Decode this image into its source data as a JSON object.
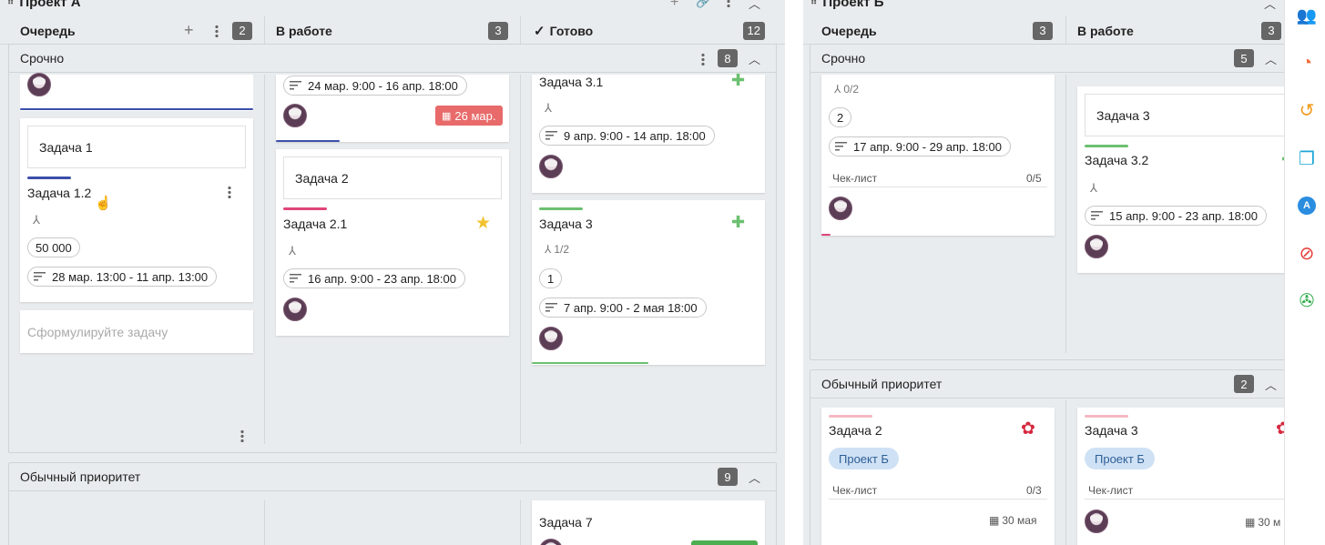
{
  "projectA": {
    "title": "Проект А",
    "columns": [
      {
        "label": "Очередь",
        "count": "2"
      },
      {
        "label": "В работе",
        "count": "3"
      },
      {
        "label": "Готово",
        "count": "12"
      }
    ],
    "urgent": {
      "label": "Срочно",
      "count": "8"
    },
    "normal": {
      "label": "Обычный приоритет",
      "count": "9"
    },
    "cards": {
      "task1_text": "Задача 1",
      "task12_title": "Задача 1.2",
      "task12_amount": "50 000",
      "task12_dates": "28 мар. 13:00 - 11 апр. 13:00",
      "new_task_placeholder": "Сформулируйте задачу",
      "top_work_dates": "24 мар. 9:00 - 16 апр. 18:00",
      "top_work_due": "26 мар.",
      "task2_text": "Задача 2",
      "task21_title": "Задача 2.1",
      "task21_dates": "16 апр. 9:00 - 23 апр. 18:00",
      "task31_title": "Задача 3.1",
      "task31_dates": "9 апр. 9:00 - 14 апр. 18:00",
      "task3_title": "Задача 3",
      "task3_sub": "1/2",
      "task3_circle": "1",
      "task3_dates": "7 апр. 9:00 - 2 мая 18:00",
      "task7_title": "Задача 7"
    }
  },
  "projectB": {
    "title": "Проект Б",
    "columns": [
      {
        "label": "Очередь",
        "count": "3"
      },
      {
        "label": "В работе",
        "count": "3"
      }
    ],
    "urgent": {
      "label": "Срочно",
      "count": "5"
    },
    "normal": {
      "label": "Обычный приоритет",
      "count": "2"
    },
    "cards": {
      "q_sub": "0/2",
      "q_circle": "2",
      "q_dates": "17 апр. 9:00 - 29 апр. 18:00",
      "q_checklist": "Чек-лист",
      "q_checklist_count": "0/5",
      "w_text": "Задача 3",
      "w_title": "Задача 3.2",
      "w_dates": "15 апр. 9:00 - 23 апр. 18:00",
      "n_task2_title": "Задача 2",
      "n_task2_tag": "Проект Б",
      "n_task2_checklist": "Чек-лист",
      "n_task2_checklist_count": "0/3",
      "n_task2_due": "30 мая",
      "n_task3_title": "Задача 3",
      "n_task3_tag": "Проект Б",
      "n_task3_checklist": "Чек-лист",
      "n_task3_due": "30 м"
    }
  },
  "colors": {
    "background": "#e9ecee",
    "blue_bar": "#3b4fa8",
    "pink_bar": "#e0457b",
    "green_bar": "#6cc070",
    "light_pink_bar": "#f5b8c2",
    "due_red": "#e86a6a",
    "tag_blue": "#cfe1f5"
  },
  "sidebar_icons": [
    "users-icon",
    "timer-icon",
    "history-icon",
    "copy-icon",
    "badge-a-icon",
    "block-icon",
    "aperture-icon"
  ]
}
